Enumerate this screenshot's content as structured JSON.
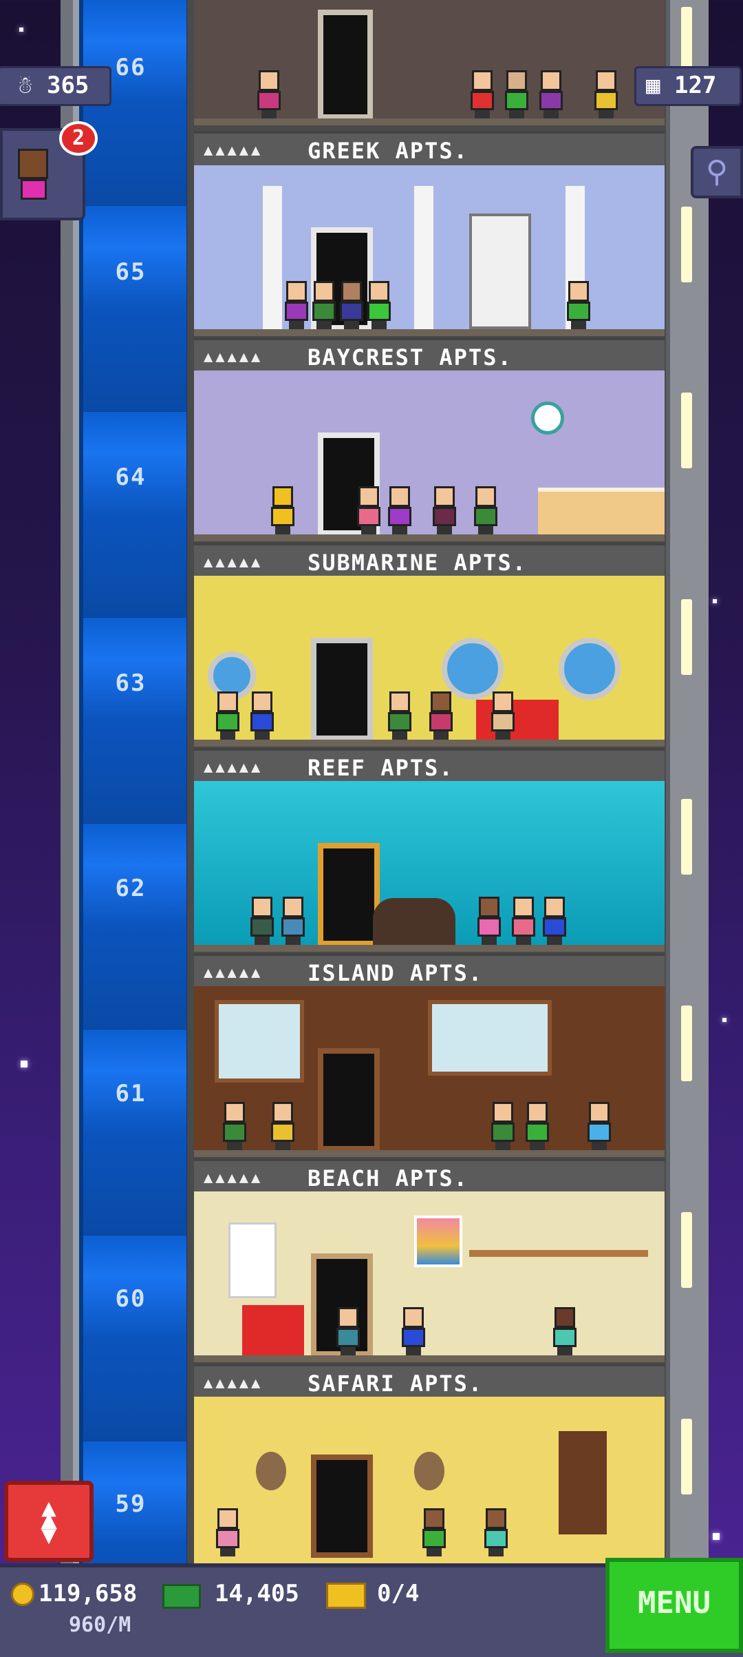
{
  "top_left_stat": {
    "icon": "population-icon",
    "value": "365"
  },
  "top_right_stat": {
    "icon": "building-floors-icon",
    "value": "127"
  },
  "notification_badge": "2",
  "search_icon": "magnifier-icon",
  "floor_numbers": [
    "66",
    "65",
    "64",
    "63",
    "62",
    "61",
    "60",
    "59"
  ],
  "floors": [
    {
      "name": "GREEK APTS.",
      "rating": "▲▲▲▲▲",
      "wall": "#d8dde8",
      "accent": "#ffffff"
    },
    {
      "name": "BAYCREST APTS.",
      "rating": "▲▲▲▲▲",
      "wall": "#a9b7e8",
      "accent": "#e8ecf5"
    },
    {
      "name": "SUBMARINE APTS.",
      "rating": "▲▲▲▲▲",
      "wall": "#b0a8d8",
      "accent": "#d8d0ee"
    },
    {
      "name": "REEF APTS.",
      "rating": "▲▲▲▲▲",
      "wall": "#e9d75a",
      "accent": "#c8c8c8"
    },
    {
      "name": "ISLAND APTS.",
      "rating": "▲▲▲▲▲",
      "wall": "#2ec6d8",
      "accent": "#0aa0b5"
    },
    {
      "name": "BEACH APTS.",
      "rating": "▲▲▲▲▲",
      "wall": "#6a3c22",
      "accent": "#8a5530"
    },
    {
      "name": "SAFARI APTS.",
      "rating": "▲▲▲▲▲",
      "wall": "#ece2b8",
      "accent": "#c4a070"
    }
  ],
  "bottom_bar": {
    "coins": "119,658",
    "coins_rate": "960/M",
    "bux": "14,405",
    "tickets": "0/4",
    "menu_label": "MENU",
    "elevator_icon": "up-down-arrows-icon"
  },
  "colors": {
    "elevator": "#1a74f0",
    "menu_green": "#2fcc28",
    "elevator_button_red": "#e63a3a"
  }
}
